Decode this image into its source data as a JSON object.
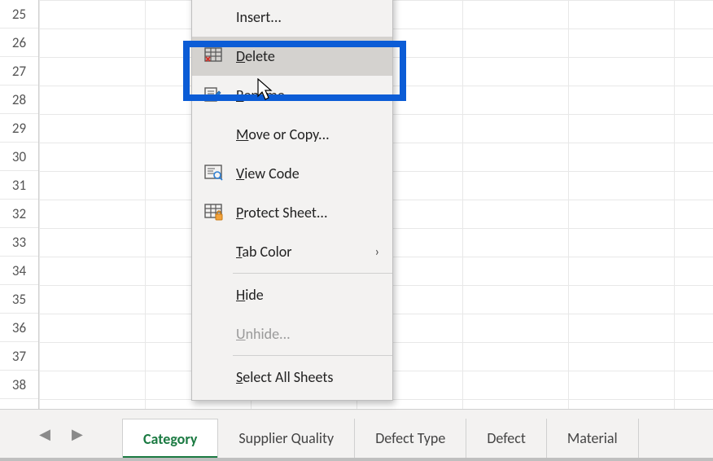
{
  "rows": [
    25,
    26,
    27,
    28,
    29,
    30,
    31,
    32,
    33,
    34,
    35,
    36,
    37,
    38
  ],
  "tabs": [
    {
      "label": "Category",
      "active": true,
      "trimmed": false
    },
    {
      "label": "Supplier Quality",
      "active": false,
      "trimmed": true
    },
    {
      "label": "Defect Type",
      "active": false,
      "trimmed": false
    },
    {
      "label": "Defect",
      "active": false,
      "trimmed": false
    },
    {
      "label": "Material",
      "active": false,
      "trimmed": false
    }
  ],
  "context_menu": {
    "items": [
      {
        "id": "insert",
        "icon": "",
        "label": "Insert...",
        "accel": "",
        "disabled": false,
        "hovered": false
      },
      {
        "id": "delete",
        "icon": "table-delete",
        "label": "Delete",
        "accel": "D",
        "disabled": false,
        "hovered": true
      },
      {
        "id": "rename",
        "icon": "rename",
        "label": "Rename",
        "accel": "R",
        "disabled": false,
        "hovered": false
      },
      {
        "id": "move",
        "icon": "",
        "label": "Move or Copy...",
        "accel": "M",
        "disabled": false,
        "hovered": false
      },
      {
        "id": "viewcode",
        "icon": "view-code",
        "label": "View Code",
        "accel": "V",
        "disabled": false,
        "hovered": false
      },
      {
        "id": "protect",
        "icon": "protect",
        "label": "Protect Sheet...",
        "accel": "P",
        "disabled": false,
        "hovered": false
      },
      {
        "id": "tabcolor",
        "icon": "",
        "label": "Tab Color",
        "accel": "T",
        "disabled": false,
        "hovered": false,
        "submenu": true
      },
      {
        "id": "hide",
        "icon": "",
        "label": "Hide",
        "accel": "H",
        "disabled": false,
        "hovered": false
      },
      {
        "id": "unhide",
        "icon": "",
        "label": "Unhide...",
        "accel": "U",
        "disabled": true,
        "hovered": false
      },
      {
        "id": "selectall",
        "icon": "",
        "label": "Select All Sheets",
        "accel": "S",
        "disabled": false,
        "hovered": false
      }
    ]
  },
  "colors": {
    "accent_green": "#1b7a42",
    "highlight_blue": "#0b5cd6"
  }
}
